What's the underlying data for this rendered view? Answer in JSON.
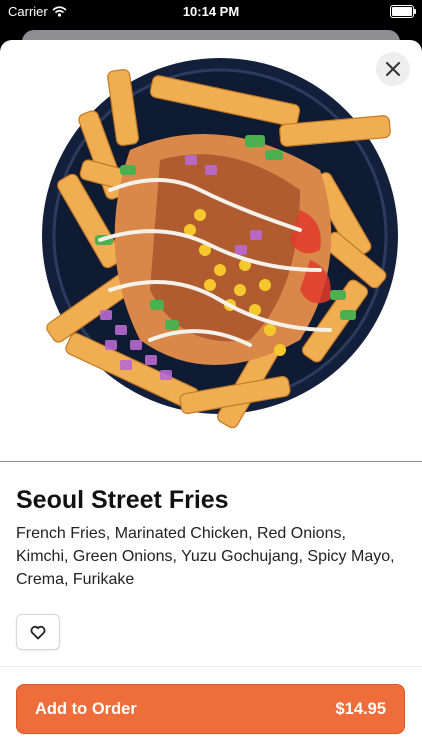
{
  "status_bar": {
    "carrier": "Carrier",
    "time": "10:14 PM"
  },
  "product": {
    "name": "Seoul Street Fries",
    "description": "French Fries, Marinated Chicken, Red Onions, Kimchi, Green Onions, Yuzu Gochujang, Spicy Mayo, Crema, Furikake",
    "image_icon": "fries-bowl-photo"
  },
  "actions": {
    "close_icon": "close-icon",
    "favorite_icon": "heart-outline-icon",
    "add_to_order_label": "Add to Order",
    "price": "$14.95"
  },
  "colors": {
    "accent": "#ee6d3a",
    "bowl": "#131f3a",
    "fries": "#f0ad52"
  }
}
